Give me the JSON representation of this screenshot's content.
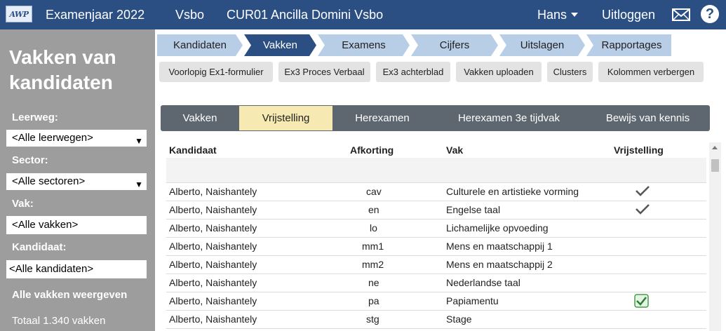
{
  "header": {
    "logo_text": "AWP",
    "exam_year": "Examenjaar 2022",
    "department": "Vsbo",
    "school": "CUR01 Ancilla Domini Vsbo",
    "user": "Hans",
    "logout": "Uitloggen",
    "mail_icon": "envelope-icon",
    "help_icon": "question-icon",
    "help_symbol": "?",
    "bar_color": "#2b4f82"
  },
  "sidebar": {
    "title": "Vakken van kandidaten",
    "leerweg_label": "Leerweg:",
    "leerweg_value": "<Alle leerwegen>",
    "sector_label": "Sector:",
    "sector_value": "<Alle sectoren>",
    "vak_label": "Vak:",
    "vak_value": "<Alle vakken>",
    "kandidaat_label": "Kandidaat:",
    "kandidaat_value": "<Alle kandidaten>",
    "show_all": "Alle vakken weergeven",
    "total": "Totaal 1.340 vakken",
    "bg_color": "#9d9d9d"
  },
  "nav": {
    "tabs": [
      {
        "label": "Kandidaten",
        "active": false
      },
      {
        "label": "Vakken",
        "active": true
      },
      {
        "label": "Examens",
        "active": false
      },
      {
        "label": "Cijfers",
        "active": false
      },
      {
        "label": "Uitslagen",
        "active": false
      },
      {
        "label": "Rapportages",
        "active": false
      }
    ],
    "active_color": "#2b4f82",
    "inactive_color": "#b8cde6"
  },
  "actions": [
    "Voorlopig Ex1-formulier",
    "Ex3 Proces Verbaal",
    "Ex3 achterblad",
    "Vakken uploaden",
    "Clusters",
    "Kolommen verbergen"
  ],
  "tabs": [
    {
      "label": "Vakken",
      "active": false
    },
    {
      "label": "Vrijstelling",
      "active": true
    },
    {
      "label": "Herexamen",
      "active": false
    },
    {
      "label": "Herexamen 3e tijdvak",
      "active": false
    },
    {
      "label": "Bewijs van kennis",
      "active": false
    }
  ],
  "table": {
    "headers": [
      "Kandidaat",
      "Afkorting",
      "Vak",
      "Vrijstelling"
    ],
    "rows": [
      {
        "kandidaat": "Alberto, Naishantely",
        "afkorting": "cav",
        "vak": "Culturele en artistieke vorming",
        "vrijstelling": "check"
      },
      {
        "kandidaat": "Alberto, Naishantely",
        "afkorting": "en",
        "vak": "Engelse taal",
        "vrijstelling": "check"
      },
      {
        "kandidaat": "Alberto, Naishantely",
        "afkorting": "lo",
        "vak": "Lichamelijke opvoeding",
        "vrijstelling": ""
      },
      {
        "kandidaat": "Alberto, Naishantely",
        "afkorting": "mm1",
        "vak": "Mens en maatschappij 1",
        "vrijstelling": ""
      },
      {
        "kandidaat": "Alberto, Naishantely",
        "afkorting": "mm2",
        "vak": "Mens en maatschappij 2",
        "vrijstelling": ""
      },
      {
        "kandidaat": "Alberto, Naishantely",
        "afkorting": "ne",
        "vak": "Nederlandse taal",
        "vrijstelling": ""
      },
      {
        "kandidaat": "Alberto, Naishantely",
        "afkorting": "pa",
        "vak": "Papiamentu",
        "vrijstelling": "check-box"
      },
      {
        "kandidaat": "Alberto, Naishantely",
        "afkorting": "stg",
        "vak": "Stage",
        "vrijstelling": ""
      }
    ]
  }
}
